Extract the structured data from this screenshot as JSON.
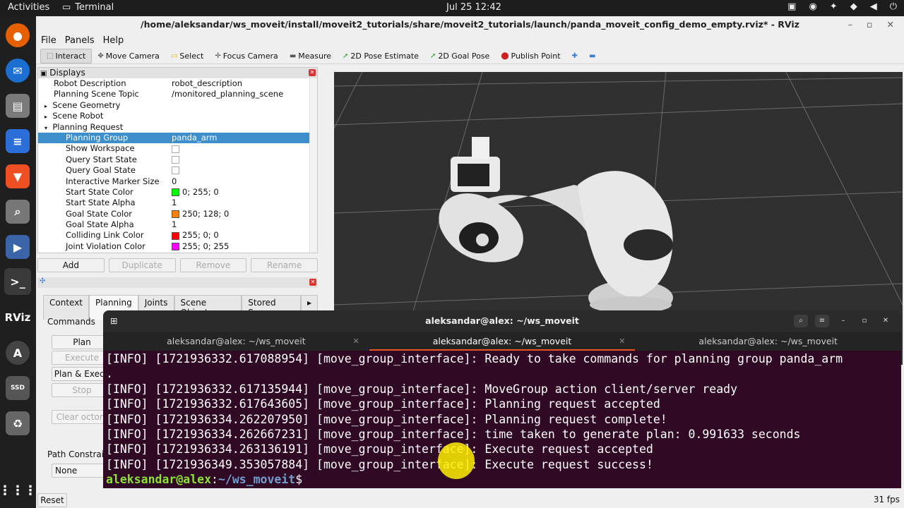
{
  "topbar": {
    "activities": "Activities",
    "app_name": "Terminal",
    "clock": "Jul 25  12:42"
  },
  "window": {
    "title": "/home/aleksandar/ws_moveit/install/moveit2_tutorials/share/moveit2_tutorials/launch/panda_moveit_config_demo_empty.rviz* - RViz"
  },
  "menu": [
    "File",
    "Panels",
    "Help"
  ],
  "toolbar": {
    "interact": "Interact",
    "move_camera": "Move Camera",
    "select": "Select",
    "focus_camera": "Focus Camera",
    "measure": "Measure",
    "pose_estimate": "2D Pose Estimate",
    "goal_pose": "2D Goal Pose",
    "publish_point": "Publish Point"
  },
  "displays": {
    "title": "Displays",
    "rows": [
      {
        "k": "Robot Description",
        "v": "robot_description"
      },
      {
        "k": "Planning Scene Topic",
        "v": "/monitored_planning_scene"
      },
      {
        "k": "Scene Geometry",
        "v": ""
      },
      {
        "k": "Scene Robot",
        "v": ""
      },
      {
        "k": "Planning Request",
        "v": ""
      },
      {
        "k": "Planning Group",
        "v": "panda_arm"
      },
      {
        "k": "Show Workspace",
        "v": ""
      },
      {
        "k": "Query Start State",
        "v": ""
      },
      {
        "k": "Query Goal State",
        "v": ""
      },
      {
        "k": "Interactive Marker Size",
        "v": "0"
      },
      {
        "k": "Start State Color",
        "v": "0; 255; 0"
      },
      {
        "k": "Start State Alpha",
        "v": "1"
      },
      {
        "k": "Goal State Color",
        "v": "250; 128; 0"
      },
      {
        "k": "Goal State Alpha",
        "v": "1"
      },
      {
        "k": "Colliding Link Color",
        "v": "255; 0; 0"
      },
      {
        "k": "Joint Violation Color",
        "v": "255; 0; 255"
      }
    ],
    "buttons": {
      "add": "Add",
      "duplicate": "Duplicate",
      "remove": "Remove",
      "rename": "Rename"
    }
  },
  "motion_planning": {
    "tabs": [
      "Context",
      "Planning",
      "Joints",
      "Scene Objects",
      "Stored Scen"
    ],
    "commands": "Commands",
    "plan": "Plan",
    "execute": "Execute",
    "plan_execute": "Plan & Execu",
    "stop": "Stop",
    "clear_octomap": "Clear octom",
    "path_constraints": "Path Constrain",
    "path_constraints_value": "None"
  },
  "terminal": {
    "title": "aleksandar@alex: ~/ws_moveit",
    "tabs": [
      "aleksandar@alex: ~/ws_moveit",
      "aleksandar@alex: ~/ws_moveit",
      "aleksandar@alex: ~/ws_moveit"
    ],
    "lines": [
      "[INFO] [1721936332.617088954] [move_group_interface]: Ready to take commands for planning group panda_arm",
      ".",
      "[INFO] [1721936332.617135944] [move_group_interface]: MoveGroup action client/server ready",
      "[INFO] [1721936332.617643605] [move_group_interface]: Planning request accepted",
      "[INFO] [1721936334.262207950] [move_group_interface]: Planning request complete!",
      "[INFO] [1721936334.262667231] [move_group_interface]: time taken to generate plan: 0.991633 seconds",
      "[INFO] [1721936334.263136191] [move_group_interface]: Execute request accepted",
      "[INFO] [1721936349.353057884] [move_group_interface]: Execute request success!"
    ],
    "prompt_user": "aleksandar@alex",
    "prompt_sep": ":",
    "prompt_path": "~/ws_moveit",
    "prompt_end": "$"
  },
  "status": {
    "reset": "Reset",
    "fps": "31 fps"
  },
  "colors": {
    "start_state": "#00ff00",
    "goal_state": "#fa8000",
    "colliding": "#ff0000",
    "joint_violation": "#ff00ff",
    "terminal_bg": "#300a24",
    "selection": "#3d8ecb"
  }
}
